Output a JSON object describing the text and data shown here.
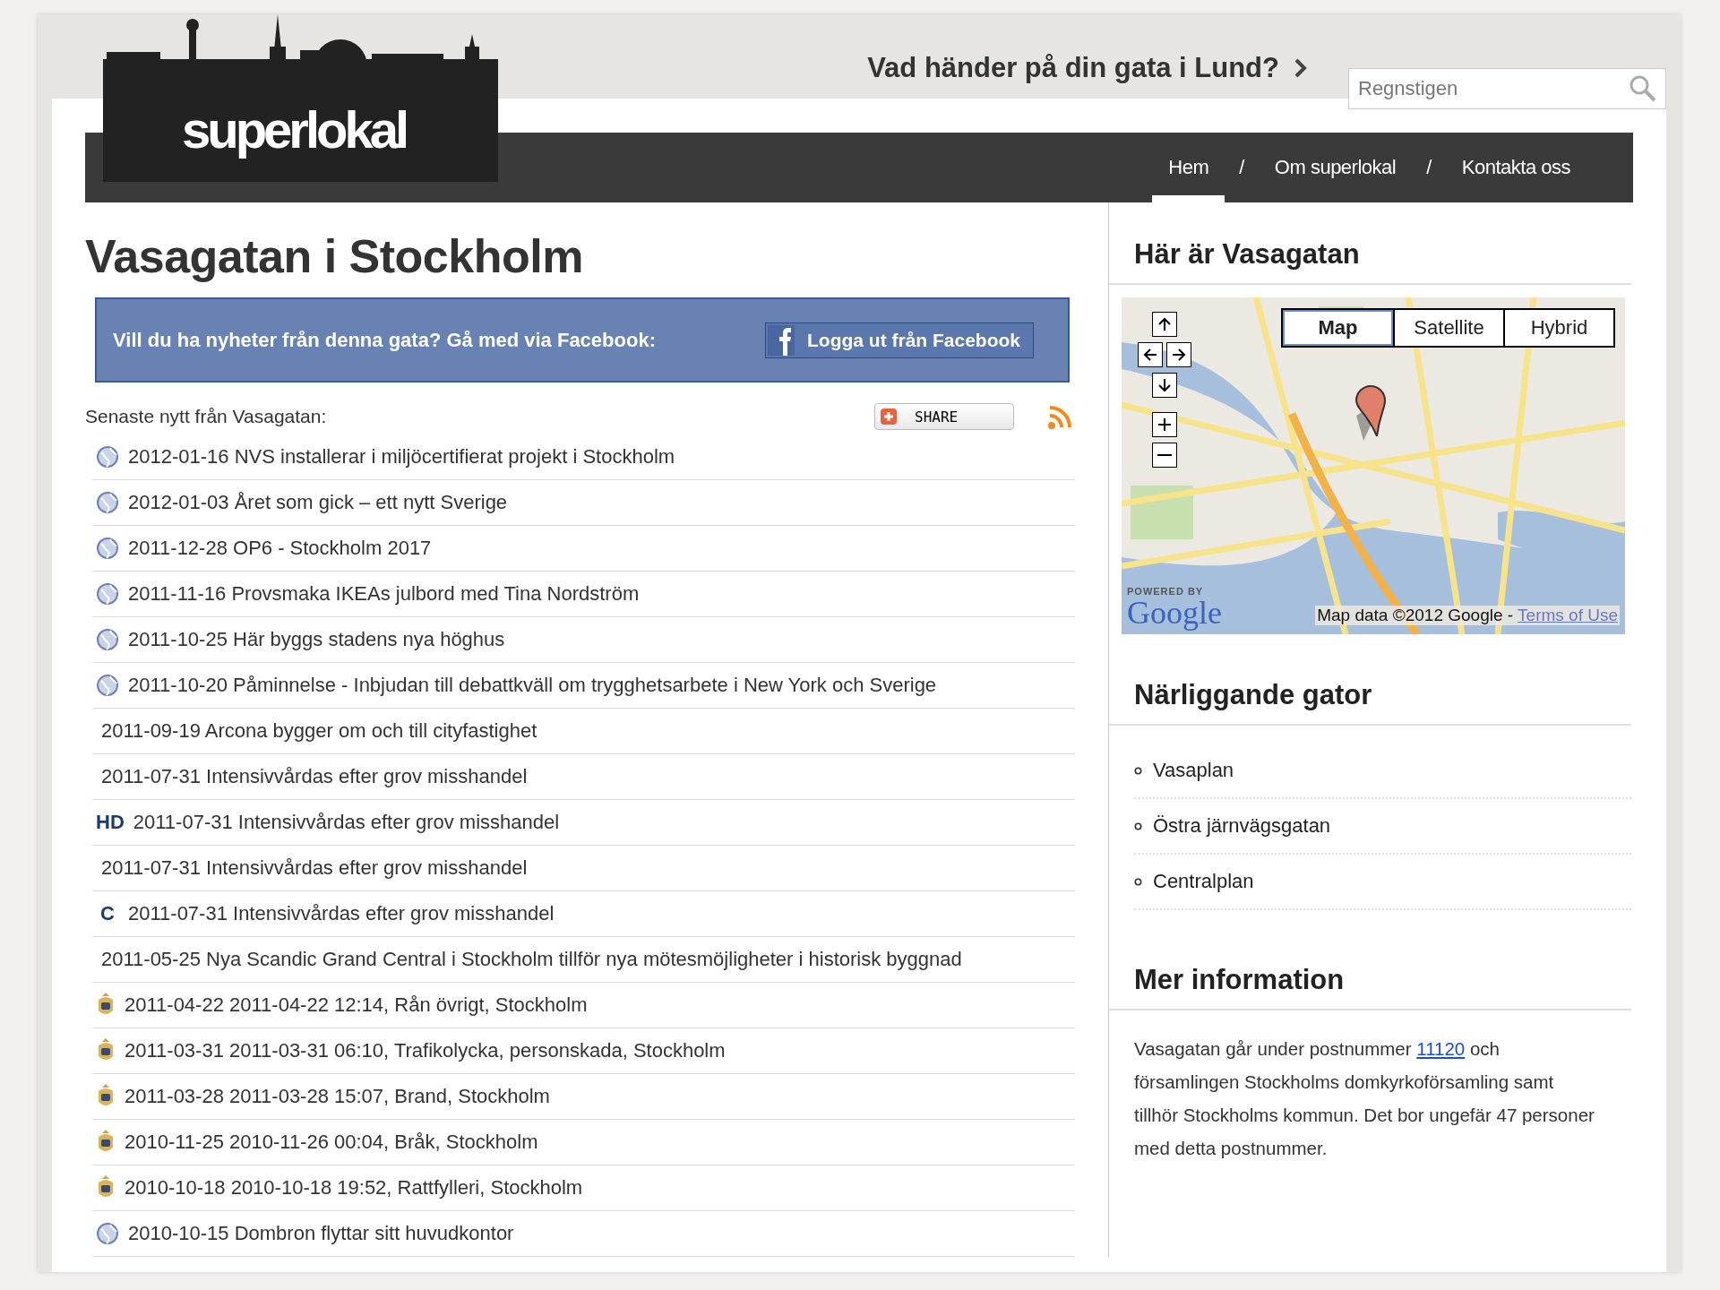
{
  "header": {
    "logo": "superlokal",
    "headline": "Vad händer på din gata i Lund?",
    "search": {
      "value": "Regnstigen"
    },
    "nav": [
      {
        "label": "Hem",
        "selected": true
      },
      {
        "label": "Om superlokal",
        "selected": false
      },
      {
        "label": "Kontakta oss",
        "selected": false
      }
    ],
    "nav_separator": "/"
  },
  "title": "Vasagatan i Stockholm",
  "facebook": {
    "text": "Vill du ha nyheter från denna gata? Gå med via Facebook:",
    "button": "Logga ut från Facebook"
  },
  "news": {
    "heading": "Senaste nytt från Vasagatan:",
    "share": "SHARE",
    "items": [
      {
        "kind": "globe",
        "text": "2012-01-16 NVS installerar i miljöcertifierat projekt i Stockholm"
      },
      {
        "kind": "globe",
        "text": "2012-01-03 Året som gick – ett nytt Sverige"
      },
      {
        "kind": "globe",
        "text": "2011-12-28 OP6 - Stockholm 2017"
      },
      {
        "kind": "globe",
        "text": "2011-11-16 Provsmaka IKEAs julbord med Tina Nordström"
      },
      {
        "kind": "globe",
        "text": "2011-10-25 Här byggs stadens nya höghus"
      },
      {
        "kind": "globe",
        "text": "2011-10-20 Påminnelse - Inbjudan till debattkväll om trygghetsarbete i New York och Sverige"
      },
      {
        "kind": "none",
        "text": "2011-09-19 Arcona bygger om och till cityfastighet"
      },
      {
        "kind": "none",
        "text": "2011-07-31 Intensivvårdas efter grov misshandel"
      },
      {
        "kind": "logo",
        "badge": "HD",
        "text": "2011-07-31 Intensivvårdas efter grov misshandel"
      },
      {
        "kind": "none",
        "text": "2011-07-31 Intensivvårdas efter grov misshandel"
      },
      {
        "kind": "logo",
        "badge": "C",
        "text": "2011-07-31 Intensivvårdas efter grov misshandel"
      },
      {
        "kind": "none",
        "text": "2011-05-25 Nya Scandic Grand Central i Stockholm tillför nya mötesmöjligheter i historisk byggnad"
      },
      {
        "kind": "police",
        "text": "2011-04-22 2011-04-22 12:14, Rån övrigt, Stockholm"
      },
      {
        "kind": "police",
        "text": "2011-03-31 2011-03-31 06:10, Trafikolycka, personskada, Stockholm"
      },
      {
        "kind": "police",
        "text": "2011-03-28 2011-03-28 15:07, Brand, Stockholm"
      },
      {
        "kind": "police",
        "text": "2010-11-25 2010-11-26 00:04, Bråk, Stockholm"
      },
      {
        "kind": "police",
        "text": "2010-10-18 2010-10-18 19:52, Rattfylleri, Stockholm"
      },
      {
        "kind": "globe",
        "text": "2010-10-15 Dombron flyttar sitt huvudkontor"
      }
    ]
  },
  "sidebar": {
    "map_heading": "Här är Vasagatan",
    "map": {
      "kind": "picture",
      "types": [
        {
          "label": "Map",
          "selected": true
        },
        {
          "label": "Satellite",
          "selected": false
        },
        {
          "label": "Hybrid",
          "selected": false
        }
      ],
      "powered_by": "POWERED BY",
      "powered_logo": "Google",
      "attribution": "Map data ©2012 Google - ",
      "terms": "Terms of Use"
    },
    "nearby_heading": "Närliggande gator",
    "nearby": [
      "Vasaplan",
      "Östra järnvägsgatan",
      "Centralplan"
    ],
    "info_heading": "Mer information",
    "info": {
      "before": "Vasagatan går under postnummer",
      "postcode": "11120",
      "after": "och församlingen Stockholms domkyrkoförsamling samt tillhör Stockholms kommun. Det bor ungefär 47 personer med detta postnummer."
    }
  }
}
